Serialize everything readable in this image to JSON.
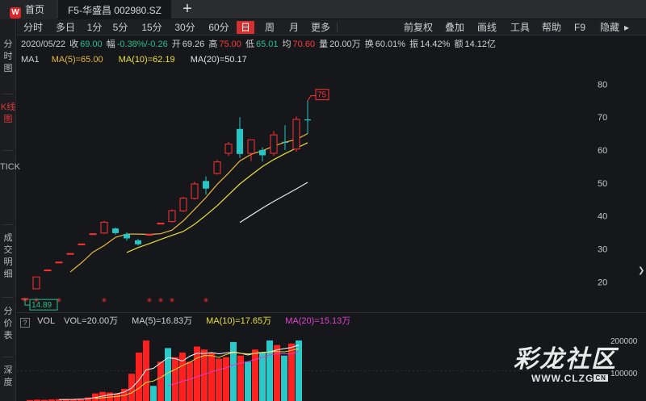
{
  "tabs": {
    "home_label": "首页",
    "home_logo": "W",
    "stock_label": "F5-华盛昌 002980.SZ",
    "add_label": "+"
  },
  "left_nav": [
    {
      "label": "分时图",
      "active": false
    },
    {
      "label": "K线图",
      "active": true
    },
    {
      "label": "TICK",
      "active": false
    },
    {
      "label": "成交明细",
      "active": false
    },
    {
      "label": "分价表",
      "active": false
    },
    {
      "label": "深度",
      "active": false
    }
  ],
  "toolbar": {
    "periods": [
      "分时",
      "多日",
      "1分",
      "5分",
      "15分",
      "30分",
      "60分",
      "日",
      "周",
      "月",
      "更多"
    ],
    "active_period": "日",
    "right_items": [
      "前复权",
      "叠加",
      "画线",
      "工具",
      "帮助",
      "F9",
      "隐藏"
    ],
    "hide_arrow": "▸"
  },
  "info": {
    "date": "2020/05/22",
    "close_label": "收",
    "close": "69.00",
    "change_label": "幅",
    "change": "-0.38%/-0.26",
    "open_label": "开",
    "open": "69.26",
    "high_label": "高",
    "high": "75.00",
    "low_label": "低",
    "low": "65.01",
    "avg_label": "均",
    "avg": "70.60",
    "volume_label": "量",
    "volume": "20.00万",
    "turnover_label": "换",
    "turnover": "60.01%",
    "amplitude_label": "振",
    "amplitude": "14.42%",
    "amount_label": "额",
    "amount": "14.12亿"
  },
  "ma": {
    "title": "MA1",
    "ma5": "MA(5)=65.00",
    "ma10": "MA(10)=62.19",
    "ma20": "MA(20)=50.17"
  },
  "volume_header": {
    "qbox": "?",
    "title": "VOL",
    "vol": "VOL=20.00万",
    "ma5": "MA(5)=16.83万",
    "ma10": "MA(10)=17.65万",
    "ma20": "MA(20)=15.13万"
  },
  "chart_data": {
    "type": "candlestick",
    "y_axis_ticks": [
      20,
      30,
      40,
      50,
      60,
      70,
      80
    ],
    "ylim": [
      12,
      83
    ],
    "high_marker": "75",
    "low_marker": "14.89",
    "candles": [
      {
        "o": 14.9,
        "h": 14.9,
        "l": 14.9,
        "c": 14.9,
        "star": true
      },
      {
        "o": 17.9,
        "h": 21.5,
        "l": 17.9,
        "c": 21.5,
        "star": true
      },
      {
        "o": 23.6,
        "h": 23.6,
        "l": 23.6,
        "c": 23.6
      },
      {
        "o": 26.0,
        "h": 26.0,
        "l": 26.0,
        "c": 26.0,
        "star": true
      },
      {
        "o": 28.6,
        "h": 28.6,
        "l": 28.6,
        "c": 28.6
      },
      {
        "o": 31.5,
        "h": 31.5,
        "l": 31.5,
        "c": 31.5
      },
      {
        "o": 34.6,
        "h": 34.6,
        "l": 34.6,
        "c": 34.6
      },
      {
        "o": 34.8,
        "h": 38.5,
        "l": 34.5,
        "c": 38.1,
        "star": true
      },
      {
        "o": 36.2,
        "h": 36.5,
        "l": 34.3,
        "c": 34.8
      },
      {
        "o": 34.5,
        "h": 35.0,
        "l": 32.5,
        "c": 33.2
      },
      {
        "o": 32.6,
        "h": 33.0,
        "l": 31.0,
        "c": 31.4
      },
      {
        "o": 34.4,
        "h": 34.4,
        "l": 34.4,
        "c": 34.4,
        "star": true
      },
      {
        "o": 37.8,
        "h": 37.8,
        "l": 37.8,
        "c": 37.8,
        "star": true
      },
      {
        "o": 38.3,
        "h": 42.0,
        "l": 38.0,
        "c": 41.6,
        "star": true
      },
      {
        "o": 41.5,
        "h": 45.8,
        "l": 41.2,
        "c": 45.4
      },
      {
        "o": 45.3,
        "h": 50.4,
        "l": 45.0,
        "c": 49.7
      },
      {
        "o": 50.6,
        "h": 52.0,
        "l": 46.5,
        "c": 48.3,
        "star": true
      },
      {
        "o": 52.9,
        "h": 57.0,
        "l": 52.5,
        "c": 56.4
      },
      {
        "o": 59.0,
        "h": 62.5,
        "l": 58.2,
        "c": 61.8
      },
      {
        "o": 66.4,
        "h": 70.0,
        "l": 57.6,
        "c": 58.8
      },
      {
        "o": 59.0,
        "h": 63.2,
        "l": 56.6,
        "c": 63.1
      },
      {
        "o": 60.0,
        "h": 60.8,
        "l": 56.5,
        "c": 58.4
      },
      {
        "o": 59.0,
        "h": 65.8,
        "l": 58.2,
        "c": 64.6
      },
      {
        "o": 62.5,
        "h": 67.5,
        "l": 60.0,
        "c": 62.2
      },
      {
        "o": 60.3,
        "h": 70.2,
        "l": 59.5,
        "c": 69.3
      },
      {
        "o": 69.3,
        "h": 75.0,
        "l": 65.0,
        "c": 69.0
      }
    ],
    "ma5": [
      null,
      null,
      null,
      null,
      23.0,
      25.8,
      29.0,
      31.0,
      33.5,
      34.5,
      34.5,
      34.4,
      34.6,
      35.7,
      38.5,
      42.0,
      45.6,
      49.6,
      53.0,
      56.7,
      58.7,
      59.8,
      61.2,
      62.4,
      63.2,
      65.0
    ],
    "ma10": [
      null,
      null,
      null,
      null,
      null,
      null,
      null,
      null,
      null,
      28.9,
      30.4,
      31.6,
      32.9,
      34.1,
      35.3,
      37.5,
      40.2,
      43.1,
      46.4,
      49.7,
      52.4,
      55.0,
      57.1,
      58.9,
      60.6,
      62.2
    ],
    "ma20": [
      null,
      null,
      null,
      null,
      null,
      null,
      null,
      null,
      null,
      null,
      null,
      null,
      null,
      null,
      null,
      null,
      null,
      null,
      null,
      38.0,
      40.2,
      42.4,
      44.4,
      46.3,
      48.2,
      50.2
    ],
    "volume": {
      "y_axis_ticks_labels": [
        "200000",
        "100000"
      ],
      "values": [
        3200,
        4500,
        3800,
        5200,
        6000,
        6200,
        5800,
        8000,
        12000,
        25000,
        30000,
        28000,
        25000,
        40000,
        90000,
        160000,
        200000,
        50000,
        130000,
        175000,
        145000,
        160000,
        130000,
        180000,
        170000,
        160000,
        140000,
        145000,
        195000,
        150000,
        130000,
        170000,
        160000,
        200000,
        185000,
        150000,
        190000,
        200000
      ],
      "colors": [
        "r",
        "r",
        "r",
        "r",
        "r",
        "r",
        "r",
        "r",
        "r",
        "r",
        "r",
        "r",
        "r",
        "r",
        "r",
        "r",
        "r",
        "g",
        "r",
        "g",
        "r",
        "r",
        "r",
        "r",
        "r",
        "r",
        "r",
        "r",
        "g",
        "r",
        "g",
        "r",
        "g",
        "g",
        "r",
        "g",
        "r",
        "g"
      ]
    }
  },
  "watermark": {
    "title": "彩龙社区",
    "url": "WWW.CLZG",
    "url_suffix": "CN"
  }
}
